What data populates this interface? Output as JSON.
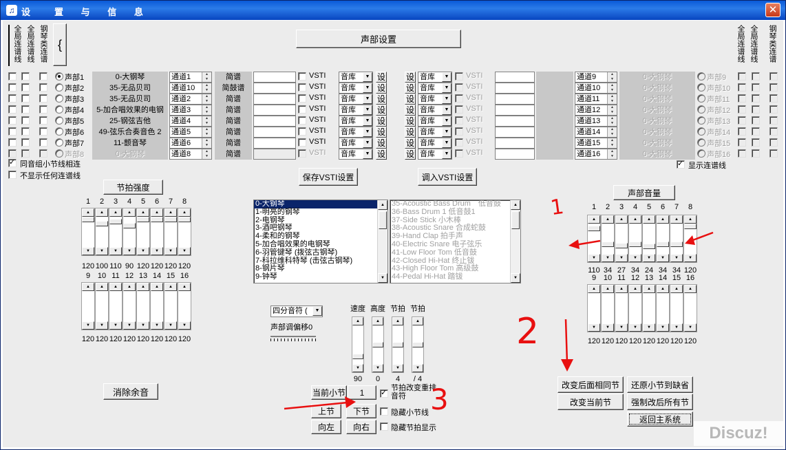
{
  "window": {
    "title": "设　置 与 信 息",
    "icon": "app-icon",
    "close": "close-icon"
  },
  "left_headers": [
    "全局连谱线",
    "全局连谱线",
    "钢琴类连谱"
  ],
  "right_headers": [
    "全局连谱线",
    "全局连谱线",
    "钢琴类连谱"
  ],
  "voice_setup_button": "声部设置",
  "left_voices": [
    {
      "voice": "声部1",
      "instrument": "0-大钢琴",
      "channel": "通道1",
      "type": "简谱",
      "enabled": true,
      "selected": true
    },
    {
      "voice": "声部2",
      "instrument": "35-无品贝司",
      "channel": "通道10",
      "type": "简鼓谱",
      "enabled": true
    },
    {
      "voice": "声部3",
      "instrument": "35-无品贝司",
      "channel": "通道2",
      "type": "简谱",
      "enabled": true
    },
    {
      "voice": "声部4",
      "instrument": "5-加合唱效果的电钢",
      "channel": "通道3",
      "type": "简谱",
      "enabled": true
    },
    {
      "voice": "声部5",
      "instrument": "25-钢弦吉他",
      "channel": "通道4",
      "type": "简谱",
      "enabled": true
    },
    {
      "voice": "声部6",
      "instrument": "49-弦乐合奏音色 2",
      "channel": "通道5",
      "type": "简谱",
      "enabled": true
    },
    {
      "voice": "声部7",
      "instrument": "11-颤音琴",
      "channel": "通道6",
      "type": "简谱",
      "enabled": true
    },
    {
      "voice": "声部8",
      "instrument": "0-大钢琴",
      "channel": "通道8",
      "type": "简谱",
      "enabled": false
    }
  ],
  "right_voices": [
    {
      "voice": "声部9",
      "channel": "通道9",
      "instrument": "0-大钢琴"
    },
    {
      "voice": "声部10",
      "channel": "通道10",
      "instrument": "0-大钢琴"
    },
    {
      "voice": "声部11",
      "channel": "通道11",
      "instrument": "0-大钢琴"
    },
    {
      "voice": "声部12",
      "channel": "通道12",
      "instrument": "0-大钢琴"
    },
    {
      "voice": "声部13",
      "channel": "通道13",
      "instrument": "0-大钢琴"
    },
    {
      "voice": "声部14",
      "channel": "通道14",
      "instrument": "0-大钢琴"
    },
    {
      "voice": "声部15",
      "channel": "通道15",
      "instrument": "0-大钢琴"
    },
    {
      "voice": "声部16",
      "channel": "通道16",
      "instrument": "0-大钢琴"
    }
  ],
  "vsti_label": "VSTI",
  "library_label": "音库",
  "set_label": "设",
  "link_same_group": "同音组小节线相连",
  "hide_all_links": "不显示任何连谱线",
  "show_links": "显示连谱线",
  "save_vsti": "保存VSTI设置",
  "load_vsti": "调入VSTI设置",
  "beat_strength": {
    "title": "节拍强度",
    "labels_top": [
      "1",
      "2",
      "3",
      "4",
      "5",
      "6",
      "7",
      "8"
    ],
    "values_top": [
      "120",
      "100",
      "110",
      "90",
      "120",
      "120",
      "120",
      "120"
    ],
    "levels_top": [
      0.0,
      0.17,
      0.08,
      0.25,
      0.0,
      0.0,
      0.0,
      0.0
    ],
    "labels_bottom": [
      "9",
      "10",
      "11",
      "12",
      "13",
      "14",
      "15",
      "16"
    ],
    "values_bottom": [
      "120",
      "120",
      "120",
      "120",
      "120",
      "120",
      "120",
      "120"
    ]
  },
  "voice_volume": {
    "title": "声部音量",
    "labels_top": [
      "1",
      "2",
      "3",
      "4",
      "5",
      "6",
      "7",
      "8"
    ],
    "values_top": [
      "110",
      "34",
      "27",
      "34",
      "24",
      "34",
      "34",
      "120"
    ],
    "levels_top": [
      0.08,
      0.72,
      0.77,
      0.72,
      0.8,
      0.72,
      0.72,
      0.0
    ],
    "labels_bottom": [
      "9",
      "10",
      "11",
      "12",
      "13",
      "14",
      "15",
      "16"
    ],
    "values_bottom": [
      "120",
      "120",
      "120",
      "120",
      "120",
      "120",
      "120",
      "120"
    ]
  },
  "instrument_list": [
    "0-大钢琴",
    "1-明亮的钢琴",
    "2-电钢琴",
    "3-酒吧钢琴",
    "4-柔和的钢琴",
    "5-加合唱效果的电钢琴",
    "6-羽管键琴 (拨弦古钢琴)",
    "7-科拉维科特琴 (击弦古钢琴)",
    "8-钢片琴",
    "9-钟琴"
  ],
  "drum_list": [
    "35-Acoustic Bass Drum　低音鼓",
    "36-Bass Drum 1 低音鼓1",
    "37-Side Stick 小木棒",
    "38-Acoustic Snare 合成蛇鼓",
    "39-Hand Clap 拍手声",
    "40-Electric Snare 电子弦乐",
    "41-Low Floor Tom 低音鼓",
    "42-Closed Hi-Hat 终止钹",
    "43-High Floor Tom 高级鼓",
    "44-Pedal Hi-Hat 踏钹"
  ],
  "note_select": "四分音符 (",
  "transpose_label": "声部调偏移0",
  "tempo": {
    "labels": [
      "速度",
      "高度",
      "节拍",
      "节拍"
    ],
    "values": [
      "90",
      "0",
      "4",
      "/ 4"
    ],
    "levels": [
      0.85,
      0.5,
      0.5,
      0.5
    ]
  },
  "clear_residual": "消除余音",
  "current_bar_label": "当前小节",
  "current_bar_value": "1",
  "beat_rearrange": "节拍改变重排音符",
  "hide_bar_lines": "隐藏小节线",
  "hide_beat_display": "隐藏节拍显示",
  "prev_bar": "上节",
  "next_bar": "下节",
  "move_left": "向左",
  "move_right": "向右",
  "change_following": "改变后面相同节",
  "restore_default": "还原小节到缺省",
  "change_current": "改变当前节",
  "force_all": "强制改后所有节",
  "return_main": "返回主系统",
  "annotations": [
    "1",
    "2",
    "3"
  ],
  "watermark": "Discuz!"
}
